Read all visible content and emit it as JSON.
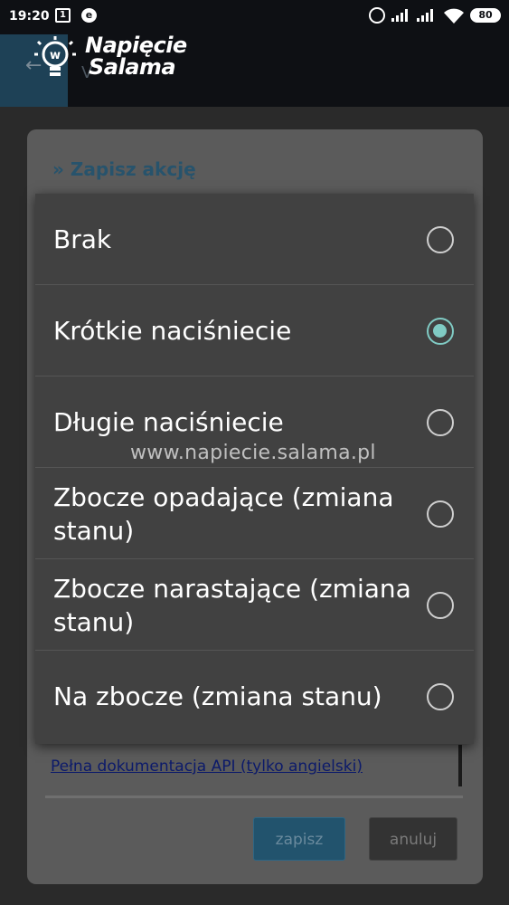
{
  "status_bar": {
    "time": "19:20",
    "calendar_day": "1",
    "e_label": "e",
    "battery": "80"
  },
  "header": {
    "logo_line1": "Napięcie",
    "logo_line2": "Salama",
    "partial_title": "V"
  },
  "background_dialog": {
    "title": "» Zapisz akcję",
    "doc_link": "Pełna dokumentacja API (tylko angielski)",
    "save_label": "zapisz",
    "cancel_label": "anuluj"
  },
  "options": [
    {
      "label": "Brak",
      "selected": false
    },
    {
      "label": "Krótkie naciśniecie",
      "selected": true
    },
    {
      "label": "Długie naciśniecie",
      "selected": false
    },
    {
      "label": "Zbocze opadające (zmiana stanu)",
      "selected": false
    },
    {
      "label": "Zbocze narastające (zmiana stanu)",
      "selected": false
    },
    {
      "label": "Na zbocze (zmiana stanu)",
      "selected": false
    }
  ],
  "watermark": "www.napiecie.salama.pl",
  "colors": {
    "accent": "#80cbc4",
    "popup_bg": "#414141",
    "title_blue": "#27536c"
  }
}
